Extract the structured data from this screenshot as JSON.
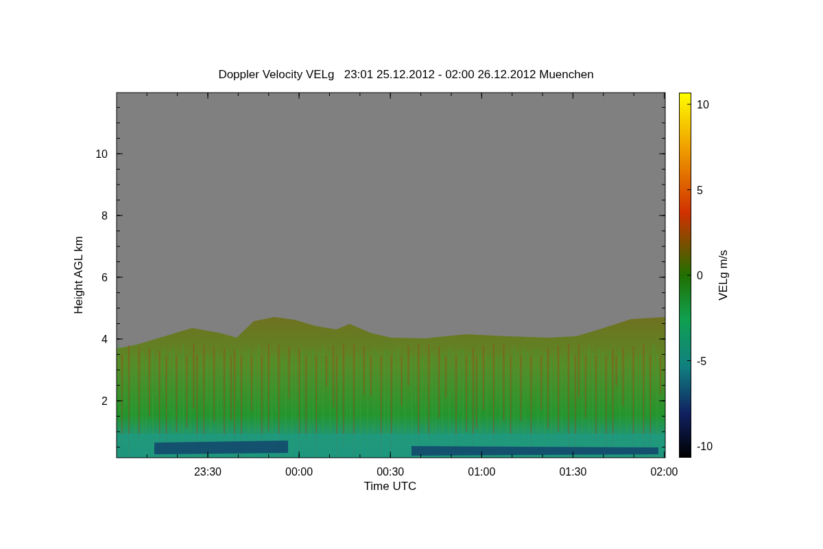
{
  "plot": {
    "title": "Doppler Velocity VELg   23:01 25.12.2012 - 02:00 26.12.2012 Muenchen",
    "x_axis": {
      "label": "Time UTC",
      "ticks": [
        "23:30",
        "00:00",
        "00:30",
        "01:00",
        "01:30",
        "02:00"
      ]
    },
    "y_axis": {
      "label": "Height AGL km",
      "ticks": [
        "10",
        "8",
        "6",
        "4",
        "2"
      ]
    },
    "colorbar": {
      "label": "VELg m/s",
      "ticks": [
        "10",
        "5",
        "0",
        "-5",
        "-10"
      ]
    }
  }
}
